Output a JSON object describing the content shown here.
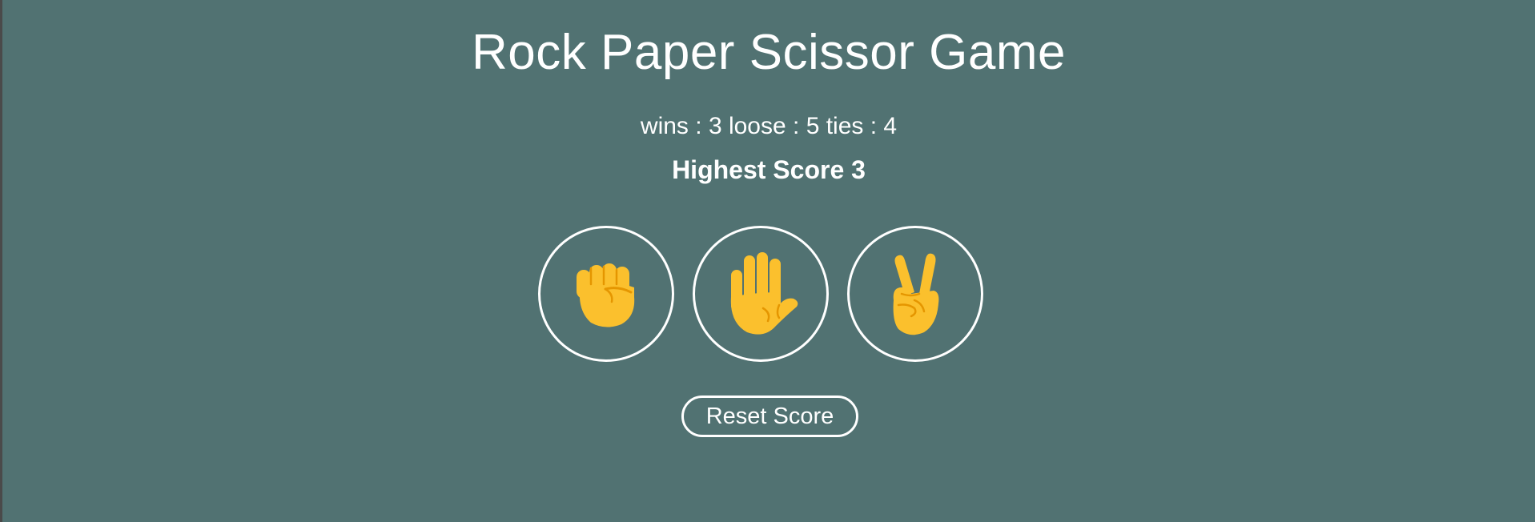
{
  "game": {
    "title": "Rock Paper Scissor Game",
    "score": {
      "wins_label": "wins : ",
      "wins": "3",
      "loose_label": " loose : ",
      "loose": "5",
      "ties_label": " ties : ",
      "ties": "4"
    },
    "highest_score_text": "Highest Score 3",
    "choices": [
      {
        "name": "rock",
        "icon": "rock-fist-icon"
      },
      {
        "name": "paper",
        "icon": "paper-hand-icon"
      },
      {
        "name": "scissor",
        "icon": "scissor-victory-hand-icon"
      }
    ],
    "reset_label": "Reset Score"
  },
  "colors": {
    "background": "#517272",
    "outer_border": "#4a4a4a",
    "foreground": "#ffffff",
    "emoji_yellow": "#FBC02D",
    "emoji_shade": "#E59600"
  }
}
